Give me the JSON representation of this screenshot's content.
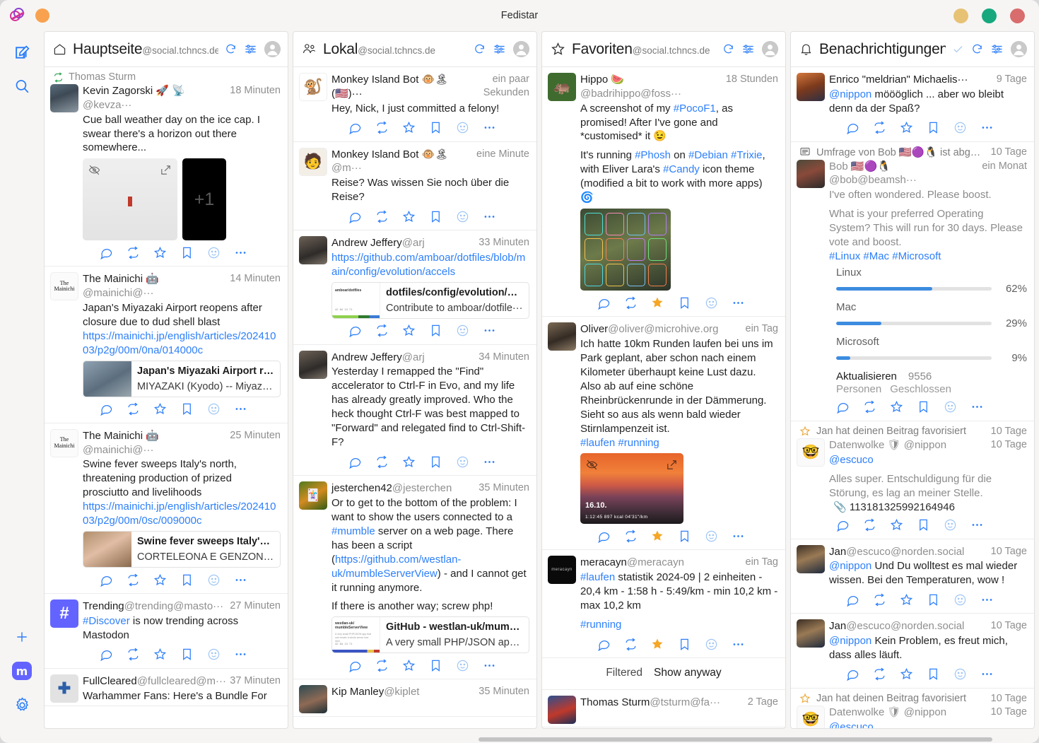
{
  "window": {
    "title": "Fedistar",
    "controls": [
      "minimize",
      "maximize",
      "close"
    ]
  },
  "sidebar": {
    "items": [
      {
        "name": "compose",
        "icon": "compose-icon"
      },
      {
        "name": "search",
        "icon": "search-icon"
      },
      {
        "name": "add-column",
        "icon": "plus-icon"
      },
      {
        "name": "mastodon-account",
        "icon": "mastodon-icon",
        "glyph": "m"
      },
      {
        "name": "settings",
        "icon": "gear-icon"
      }
    ]
  },
  "columns": [
    {
      "id": "home",
      "icon": "home-icon",
      "title": "Hauptseite",
      "account": "@social.tchncs.de",
      "actions": [
        "refresh-icon",
        "settings-sliders-icon",
        "avatar-icon"
      ],
      "statuses": [
        {
          "boost_by": "Thomas Sturm",
          "display_name": "Kevin Zagorski 🚀 📡",
          "acct": "@kevza···",
          "time": "18 Minuten",
          "body": "Cue ball weather day on the ice cap. I swear there's a horizon out there somewhere...",
          "media": {
            "type": "gallery",
            "hidden": true,
            "extra_label": "+1"
          },
          "actions": [
            "reply-icon",
            "boost-icon",
            "favourite-icon",
            "bookmark-icon",
            "emoji-icon",
            "more-icon"
          ]
        },
        {
          "display_name": "The Mainichi 🤖",
          "acct": "@mainichi@···",
          "time": "14 Minuten",
          "body": "Japan's Miyazaki Airport reopens after closure due to dud shell blast ",
          "link": "https://mainichi.jp/english/articles/20241003/p2g/00m/0na/014000c",
          "card": {
            "title": "Japan's Miyazaki Airport re···",
            "desc": "MIYAZAKI (Kyodo) -- Miyazaki ···"
          }
        },
        {
          "display_name": "The Mainichi 🤖",
          "acct": "@mainichi@···",
          "time": "25 Minuten",
          "body": "Swine fever sweeps Italy's north, threatening production of prized prosciutto and livelihoods ",
          "link": "https://mainichi.jp/english/articles/20241003/p2g/00m/0sc/009000c",
          "card": {
            "title": "Swine fever sweeps Italy's ···",
            "desc": "CORTELEONA E GENZONE, Ita···"
          }
        },
        {
          "display_name": "Trending",
          "acct": "@trending@masto···",
          "time": "27 Minuten",
          "hashtag": "#Discover",
          "body": " is now trending across Mastodon"
        },
        {
          "display_name": "FullCleared",
          "acct": "@fullcleared@m···",
          "time": "37 Minuten",
          "body": "Warhammer Fans: Here's a Bundle For"
        }
      ]
    },
    {
      "id": "local",
      "icon": "people-icon",
      "title": "Lokal",
      "account": "@social.tchncs.de",
      "actions": [
        "refresh-icon",
        "settings-sliders-icon",
        "avatar-icon"
      ],
      "statuses": [
        {
          "display_name": "Monkey Island Bot 🐵🏝 (🇺🇸)···",
          "acct": "",
          "time": "ein paar Sekunden",
          "body": "Hey, Nick, I just committed a felony!"
        },
        {
          "display_name": "Monkey Island Bot 🐵🏝",
          "acct": "@m···",
          "time": "eine Minute",
          "body": "Reise? Was wissen Sie noch über die Reise?"
        },
        {
          "display_name": "Andrew Jeffery",
          "acct": "@arj",
          "time": "33 Minuten",
          "link": "https://github.com/amboar/dotfiles/blob/main/config/evolution/accels",
          "body": "",
          "card": {
            "title": "dotfiles/config/evolution/ac···",
            "desc": "Contribute to amboar/dotfile···"
          }
        },
        {
          "display_name": "Andrew Jeffery",
          "acct": "@arj",
          "time": "34 Minuten",
          "body": "Yesterday I remapped the \"Find\" accelerator to Ctrl-F in Evo, and my life has already greatly improved. Who the heck thought Ctrl-F was best mapped to \"Forward\" and relegated find to Ctrl-Shift-F?"
        },
        {
          "display_name": "jesterchen42",
          "acct": "@jesterchen",
          "time": "35 Minuten",
          "body_pre": "Or to get to the bottom of the problem: I want to show the users connected to a ",
          "hashtag": "#mumble",
          "body_mid": " server on a web page. There has been a script (",
          "inline_link": "https://github.com/westlan-uk/mumbleServerView",
          "body_post": ") - and I cannot get it running anymore.",
          "body2": "If there is another way; screw php!",
          "card": {
            "title": "GitHub - westlan-uk/mumb···",
            "desc": "A very small PHP/JSON app t···"
          }
        },
        {
          "display_name": "Kip Manley",
          "acct": "@kiplet",
          "time": "35 Minuten",
          "body": ""
        }
      ]
    },
    {
      "id": "favourites",
      "icon": "star-icon",
      "title": "Favoriten",
      "account": "@social.tchncs.de",
      "actions": [
        "refresh-icon",
        "settings-sliders-icon",
        "avatar-icon"
      ],
      "statuses": [
        {
          "display_name": "Hippo 🍉",
          "acct": "@badrihippo@foss···",
          "time": "18 Stunden",
          "body_pre": "A screenshot of my ",
          "hashtag": "#PocoF1",
          "body_post": ", as promised! After I've gone and *customised* it 😉",
          "body2_pre": "It's running ",
          "tags2": [
            "#Phosh",
            "#Debian",
            "#Trixie",
            "#Candy"
          ],
          "body2": "It's running #Phosh on #Debian #Trixie, with Eliver Lara's #Candy icon theme (modified a bit to work with more apps) ",
          "favourited": true
        },
        {
          "display_name": "Oliver",
          "acct": "@oliver@microhive.org",
          "time": "ein Tag",
          "body": "Ich hatte 10km Runden laufen bei uns im Park geplant, aber schon nach einem Kilometer überhaupt keine Lust dazu. Also ab auf eine schöne Rheinbrückenrunde in der Dämmerung. Sieht so aus als wenn bald wieder Stirnlampenzeit ist.",
          "tags": [
            "#laufen",
            "#running"
          ],
          "media_overlay": {
            "date": "16.10.",
            "stats": "1:12:45   897 kcal   04'31\"/km"
          },
          "favourited": true
        },
        {
          "display_name": "meracayn",
          "acct": "@meracayn",
          "time": "ein Tag",
          "hashtag": "#laufen",
          "body": " statistik 2024-09 | 2 einheiten - 20,4 km - 1:58 h - 5:49/km - min 10,2 km - max 10,2 km",
          "tags": [
            "#running"
          ],
          "favourited": true
        }
      ],
      "filtered": {
        "label": "Filtered",
        "action": "Show anyway"
      },
      "filtered_status": {
        "display_name": "Thomas Sturm",
        "acct": "@tsturm@fa···",
        "time": "2 Tage"
      }
    },
    {
      "id": "notifications",
      "icon": "bell-icon",
      "title": "Benachrichtigungen···",
      "account": "",
      "actions": [
        "mark-read-check-icon",
        "refresh-icon",
        "settings-sliders-icon",
        "avatar-icon"
      ],
      "statuses": [
        {
          "display_name": "Enrico \"meldrian\" Michaelis···",
          "acct": "",
          "time": "9 Tage",
          "mention": "@nippon",
          "body": " möööglich ... aber wo bleibt denn da der Spaß?"
        },
        {
          "notif_header": "Umfrage von Bob 🇺🇸🟣🐧 ist abge···",
          "notif_header_time": "10 Tage",
          "notif_icon": "poll-icon",
          "display_name": "Bob 🇺🇸🟣🐧",
          "acct": "@bob@beamsh···",
          "time": "ein Monat",
          "body_first": "I've often wondered. Please boost.",
          "body": "What is your preferred Operating System? This will run for 30 days. Please vote and boost.",
          "tags": [
            "#Linux",
            "#Mac",
            "#Microsoft"
          ],
          "poll": {
            "options": [
              {
                "label": "Linux",
                "pct": 62
              },
              {
                "label": "Mac",
                "pct": 29
              },
              {
                "label": "Microsoft",
                "pct": 9
              }
            ],
            "refresh_label": "Aktualisieren",
            "votes": "9556",
            "people_label": "Personen",
            "closed_label": "Geschlossen"
          }
        },
        {
          "notif_header": "Jan hat deinen Beitrag favorisiert",
          "notif_header_time": "10 Tage",
          "notif_icon": "star-icon",
          "display_name": "Datenwolke 🛡",
          "acct": "@nippon",
          "time": "10 Tage",
          "mention": "@escuco",
          "body": "Alles super. Entschuldigung für die Störung, es lag an meiner Stelle.",
          "attachment_id": "113181325992164946"
        },
        {
          "display_name": "Jan",
          "acct": "@escuco@norden.social",
          "time": "10 Tage",
          "mention": "@nippon",
          "body": " Und Du wolltest es mal wieder wissen. Bei den Temperaturen, wow !"
        },
        {
          "display_name": "Jan",
          "acct": "@escuco@norden.social",
          "time": "10 Tage",
          "mention": "@nippon",
          "body": " Kein Problem, es freut mich, dass alles läuft."
        },
        {
          "notif_header": "Jan hat deinen Beitrag favorisiert",
          "notif_header_time": "10 Tage",
          "notif_icon": "star-icon",
          "display_name": "Datenwolke 🛡",
          "acct": "@nippon",
          "time": "10 Tage",
          "mention": "@escuco"
        }
      ]
    }
  ],
  "colors": {
    "accent": "#2d7ff9",
    "favourite": "#f5a623",
    "poll_fill": "#3c8ce0",
    "link": "#2d7ff9"
  }
}
